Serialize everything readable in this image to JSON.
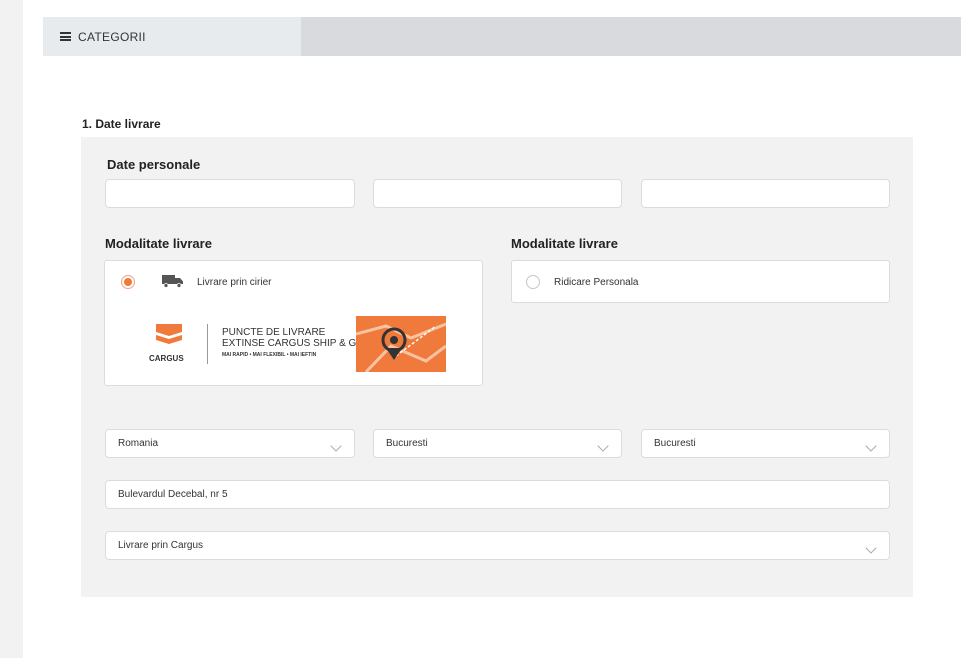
{
  "nav": {
    "categories_label": "CATEGORII"
  },
  "section": {
    "title": "1. Date livrare"
  },
  "personal": {
    "heading": "Date personale",
    "fields": [
      "",
      "",
      ""
    ]
  },
  "delivery": {
    "heading_left": "Modalitate livrare",
    "heading_right": "Modalitate livrare",
    "courier_label": "Livrare prin cirier",
    "pickup_label": "Ridicare Personala",
    "selected": "courier"
  },
  "banner": {
    "brand": "CARGUS",
    "line1": "PUNCTE DE LIVRARE",
    "line2": "EXTINSE CARGUS SHIP & GO",
    "tagline": "MAI RAPID • MAI FLEXIBIL • MAI IEFTIN"
  },
  "address": {
    "country": "Romania",
    "county": "Bucuresti",
    "city": "Bucuresti",
    "street": "Bulevardul Decebal, nr 5",
    "shipping_method": "Livrare prin Cargus"
  },
  "colors": {
    "accent": "#f07a3b",
    "panel": "#f2f2f2",
    "topbar": "#d8dadd"
  }
}
